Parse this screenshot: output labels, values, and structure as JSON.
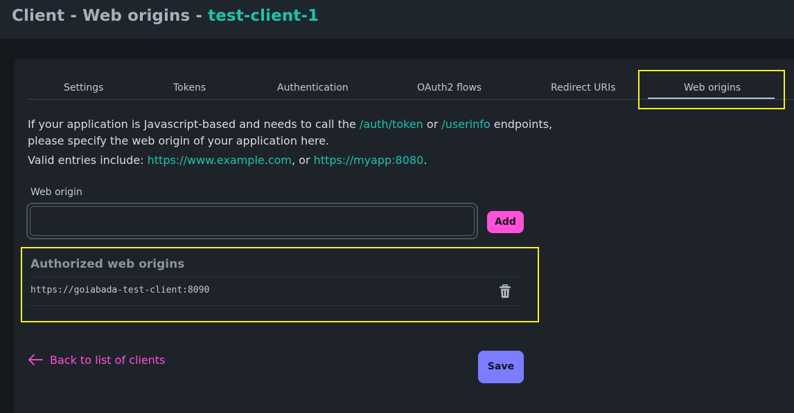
{
  "header": {
    "title_prefix": "Client - Web origins - ",
    "client_name": "test-client-1"
  },
  "tabs": [
    {
      "label": "Settings",
      "active": false
    },
    {
      "label": "Tokens",
      "active": false
    },
    {
      "label": "Authentication",
      "active": false
    },
    {
      "label": "OAuth2 flows",
      "active": false
    },
    {
      "label": "Redirect URIs",
      "active": false
    },
    {
      "label": "Web origins",
      "active": true
    }
  ],
  "description": {
    "line1_a": "If your application is Javascript-based and needs to call the ",
    "line1_link1": "/auth/token",
    "line1_b": " or ",
    "line1_link2": "/userinfo",
    "line1_c": " endpoints,",
    "line2": "please specify the web origin of your application here.",
    "line3_a": "Valid entries include: ",
    "line3_link1": "https://www.example.com",
    "line3_b": ", or ",
    "line3_link2": "https://myapp:8080",
    "line3_c": "."
  },
  "form": {
    "web_origin_label": "Web origin",
    "web_origin_value": "",
    "add_label": "Add"
  },
  "authorized": {
    "title": "Authorized web origins",
    "origins": [
      "https://goiabada-test-client:8090"
    ]
  },
  "footer": {
    "back_label": "Back to list of clients",
    "save_label": "Save"
  },
  "colors": {
    "accent_teal": "#1fc2ae",
    "accent_pink": "#ff52d9",
    "save_purple": "#7b7cff",
    "highlight_yellow": "#f7f21c"
  },
  "icons": {
    "delete": "trash-icon",
    "back": "arrow-left-icon"
  }
}
